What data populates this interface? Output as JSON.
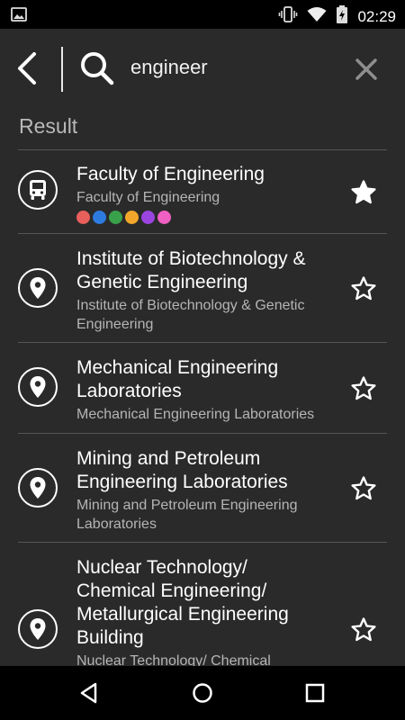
{
  "status_bar": {
    "time": "02:29",
    "icons": [
      "image-icon",
      "vibrate-icon",
      "wifi-icon",
      "battery-charging-icon"
    ]
  },
  "search": {
    "query": "engineer",
    "back_icon": "chevron-left-icon",
    "search_icon": "search-icon",
    "clear_icon": "close-icon"
  },
  "results": {
    "label": "Result",
    "items": [
      {
        "title": "Faculty of Engineering",
        "subtitle": "Faculty of Engineering",
        "icon": "bus-icon",
        "favorited": true,
        "route_colors": [
          "#e85f5c",
          "#2e7be0",
          "#39a14a",
          "#f2a72a",
          "#9b45e0",
          "#f05fc2"
        ]
      },
      {
        "title": "Institute of Biotechnology & Genetic Engineering",
        "subtitle": "Institute of Biotechnology & Genetic Engineering",
        "icon": "location-pin-icon",
        "favorited": false
      },
      {
        "title": "Mechanical Engineering Laboratories",
        "subtitle": "Mechanical Engineering Laboratories",
        "icon": "location-pin-icon",
        "favorited": false
      },
      {
        "title": "Mining and Petroleum Engineering Laboratories",
        "subtitle": "Mining and Petroleum Engineering Laboratories",
        "icon": "location-pin-icon",
        "favorited": false
      },
      {
        "title": "Nuclear Technology/ Chemical Engineering/ Metallurgical Engineering Building",
        "subtitle": "Nuclear Technology/ Chemical",
        "icon": "location-pin-icon",
        "favorited": false
      }
    ]
  },
  "nav_bar": {
    "buttons": [
      "back-triangle-icon",
      "home-circle-icon",
      "recents-square-icon"
    ]
  }
}
